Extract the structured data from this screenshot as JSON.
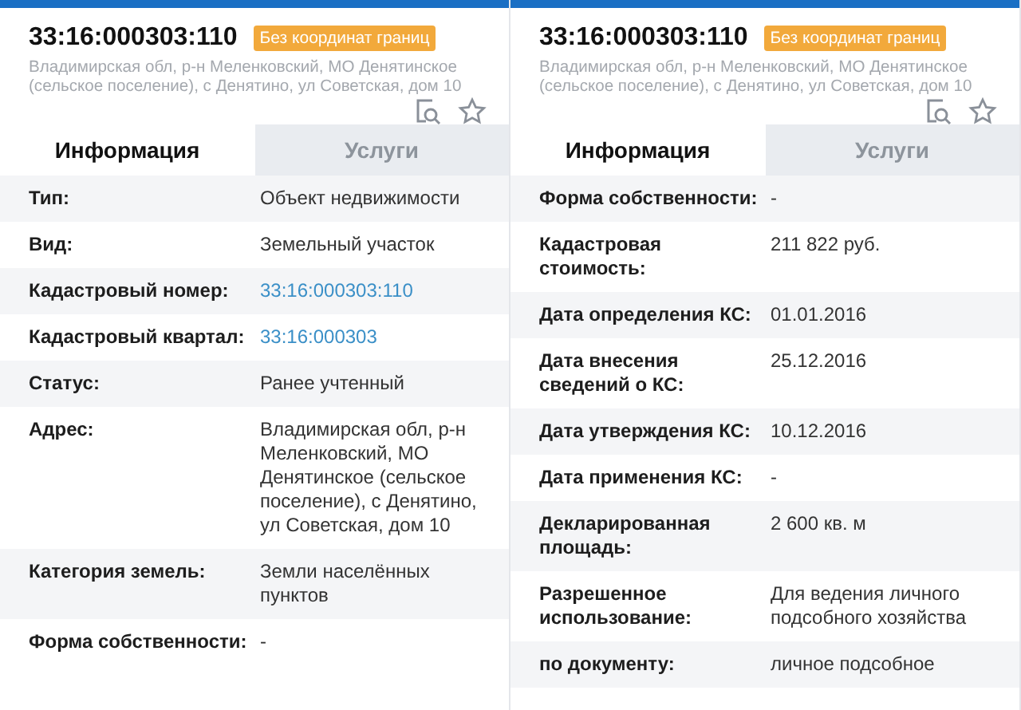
{
  "panels": [
    {
      "cadastral_number": "33:16:000303:110",
      "badge": "Без координат границ",
      "address": "Владимирская обл, р-н Меленковский, МО Денятинское (сельское поселение), с Денятино, ул Советская, дом 10",
      "tabs": [
        {
          "label": "Информация",
          "selected": true
        },
        {
          "label": "Услуги",
          "selected": false
        }
      ],
      "rows": [
        {
          "label": "Тип:",
          "value": "Объект недвижимости",
          "kind": "text"
        },
        {
          "label": "Вид:",
          "value": "Земельный участок",
          "kind": "text"
        },
        {
          "label": "Кадастровый номер:",
          "value": "33:16:000303:110",
          "kind": "link"
        },
        {
          "label": "Кадастровый квартал:",
          "value": "33:16:000303",
          "kind": "link"
        },
        {
          "label": "Статус:",
          "value": "Ранее учтенный",
          "kind": "text"
        },
        {
          "label": "Адрес:",
          "value": "Владимирская обл, р-н Меленковский, МО Денятинское (сельское поселение), с Денятино, ул Советская, дом 10",
          "kind": "text"
        },
        {
          "label": "Категория земель:",
          "value": "Земли населённых пунктов",
          "kind": "text"
        },
        {
          "label": "Форма собственности:",
          "value": "-",
          "kind": "text"
        }
      ]
    },
    {
      "cadastral_number": "33:16:000303:110",
      "badge": "Без координат границ",
      "address": "Владимирская обл, р-н Меленковский, МО Денятинское (сельское поселение), с Денятино, ул Советская, дом 10",
      "tabs": [
        {
          "label": "Информация",
          "selected": true
        },
        {
          "label": "Услуги",
          "selected": false
        }
      ],
      "rows": [
        {
          "label": "Форма собственности:",
          "value": "-",
          "kind": "text"
        },
        {
          "label": "Кадастровая стоимость:",
          "value": "211 822 руб.",
          "kind": "text"
        },
        {
          "label": "Дата определения КС:",
          "value": "01.01.2016",
          "kind": "text"
        },
        {
          "label": "Дата внесения сведений о КС:",
          "value": "25.12.2016",
          "kind": "text"
        },
        {
          "label": "Дата утверждения КС:",
          "value": "10.12.2016",
          "kind": "text"
        },
        {
          "label": "Дата применения КС:",
          "value": "-",
          "kind": "text"
        },
        {
          "label": "Декларированная площадь:",
          "value": "2 600 кв. м",
          "kind": "text"
        },
        {
          "label": "Разрешенное использование:",
          "value": "Для ведения личного подсобного хозяйства",
          "kind": "text"
        },
        {
          "label": "по документу:",
          "value": "личное подсобное",
          "kind": "text"
        }
      ]
    }
  ]
}
